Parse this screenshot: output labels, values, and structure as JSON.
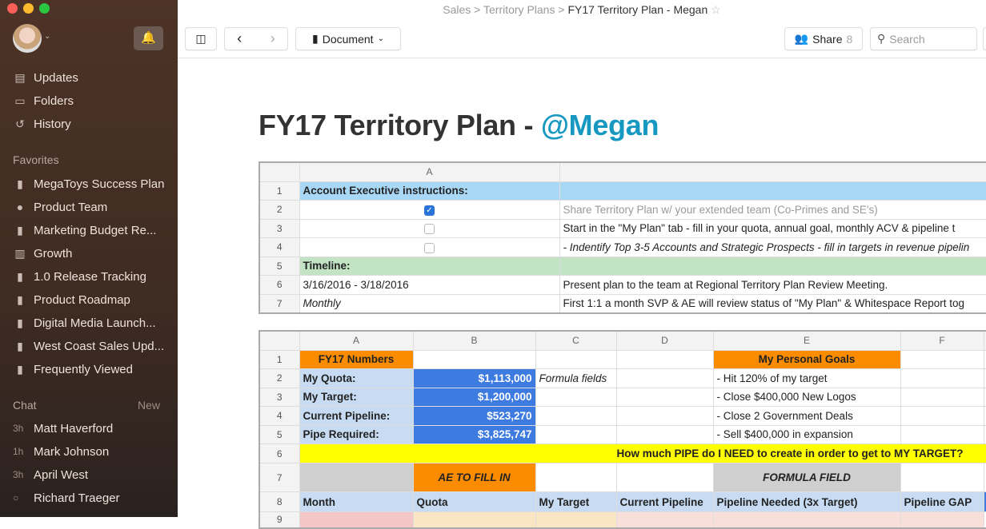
{
  "window": {
    "controls": [
      "close",
      "minimize",
      "zoom"
    ]
  },
  "sidebar": {
    "nav": [
      {
        "label": "Updates",
        "icon": "calendar-icon"
      },
      {
        "label": "Folders",
        "icon": "folder-icon"
      },
      {
        "label": "History",
        "icon": "history-icon"
      }
    ],
    "favorites_label": "Favorites",
    "favorites": [
      {
        "label": "MegaToys Success Plan",
        "icon": "document-icon"
      },
      {
        "label": "Product Team",
        "icon": "chat-icon"
      },
      {
        "label": "Marketing Budget Re...",
        "icon": "document-icon"
      },
      {
        "label": "Growth",
        "icon": "notebook-icon"
      },
      {
        "label": "1.0 Release Tracking",
        "icon": "document-icon"
      },
      {
        "label": "Product Roadmap",
        "icon": "document-icon"
      },
      {
        "label": "Digital Media Launch...",
        "icon": "document-icon"
      },
      {
        "label": "West Coast Sales Upd...",
        "icon": "document-icon"
      },
      {
        "label": "Frequently Viewed",
        "icon": "documents-icon"
      }
    ],
    "chat_label": "Chat",
    "chat_new": "New",
    "chats": [
      {
        "time": "3h",
        "name": "Matt Haverford"
      },
      {
        "time": "1h",
        "name": "Mark Johnson"
      },
      {
        "time": "3h",
        "name": "April West"
      },
      {
        "time": "○",
        "name": "Richard Traeger"
      }
    ]
  },
  "breadcrumb": {
    "items": [
      "Sales",
      "Territory Plans"
    ],
    "current": "FY17 Territory Plan - Megan"
  },
  "toolbar": {
    "document_label": "Document",
    "share_label": "Share",
    "share_count": "8",
    "search_placeholder": "Search"
  },
  "page": {
    "title": "FY17 Territory Plan - ",
    "mention": "@Megan"
  },
  "sheet1": {
    "columns": [
      "",
      "A",
      ""
    ],
    "rows": [
      {
        "n": "1",
        "a": "Account Executive instructions:",
        "b": "",
        "style": "blue"
      },
      {
        "n": "2",
        "check": true,
        "b": "Share Territory Plan w/ your extended team (Co-Primes and SE's)",
        "bstyle": "gray"
      },
      {
        "n": "3",
        "check": false,
        "b": "Start in the \"My Plan\" tab - fill in your quota, annual goal, monthly ACV & pipeline t"
      },
      {
        "n": "4",
        "check": false,
        "b": "- Indentify Top 3-5 Accounts and Strategic Prospects - fill in targets in revenue pipelin",
        "bstyle": "italic"
      },
      {
        "n": "5",
        "a": "Timeline:",
        "b": "",
        "style": "green"
      },
      {
        "n": "6",
        "a": "3/16/2016 - 3/18/2016",
        "b": "Present plan to the team at Regional Territory Plan Review Meeting."
      },
      {
        "n": "7",
        "a": "Monthly",
        "astyle": "italic",
        "b": "First 1:1 a month SVP & AE will review status of \"My Plan\" & Whitespace Report tog"
      }
    ]
  },
  "sheet2": {
    "columns": [
      "A",
      "B",
      "C",
      "D",
      "E",
      "F"
    ],
    "rows": [
      {
        "n": "1",
        "cells": [
          "FY17 Numbers",
          "",
          "",
          "",
          "My Personal Goals",
          ""
        ]
      },
      {
        "n": "2",
        "cells": [
          "My Quota:",
          "$1,113,000",
          "Formula fields",
          "",
          "- Hit 120% of my target",
          ""
        ]
      },
      {
        "n": "3",
        "cells": [
          "My Target:",
          "$1,200,000",
          "",
          "",
          "- Close $400,000 New Logos",
          ""
        ]
      },
      {
        "n": "4",
        "cells": [
          "Current Pipeline:",
          "$523,270",
          "",
          "",
          "- Close 2 Government Deals",
          ""
        ]
      },
      {
        "n": "5",
        "cells": [
          "Pipe Required:",
          "$3,825,747",
          "",
          "",
          "- Sell $400,000 in expansion",
          ""
        ]
      },
      {
        "n": "6",
        "banner": "How much PIPE do I NEED to create in order to get to MY TARGET?"
      },
      {
        "n": "7",
        "cells": [
          "",
          "AE TO FILL IN",
          "",
          "",
          "FORMULA FIELD",
          ""
        ]
      },
      {
        "n": "8",
        "cells": [
          "Month",
          "Quota",
          "My Target",
          "Current Pipeline",
          "Pipeline Needed (3x Target)",
          "Pipeline GAP"
        ]
      },
      {
        "n": "9",
        "cells": [
          "",
          "",
          "",
          "",
          "",
          ""
        ]
      }
    ]
  },
  "colors": {
    "orange": "#fb8c00",
    "blue_cell": "#3d7be0",
    "light_blue": "#c7dcf3",
    "yellow": "#ffff00",
    "gray": "#cfcfcf",
    "header_blue": "#a9d8f7",
    "green": "#c2e3c4",
    "accent": "#1798c1"
  }
}
